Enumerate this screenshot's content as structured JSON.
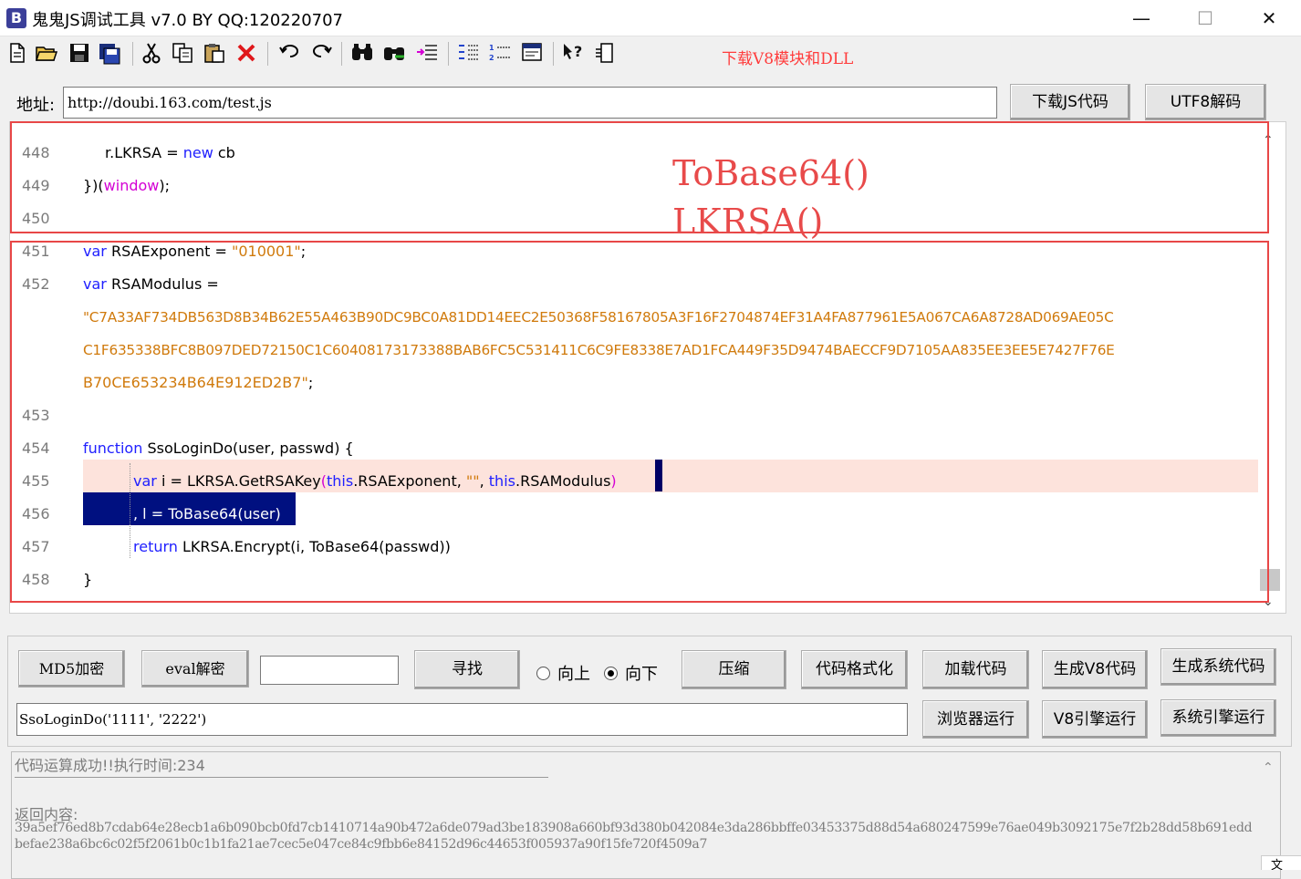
{
  "window": {
    "title": "鬼鬼JS调试工具 v7.0 BY QQ:120220707",
    "app_icon_letter": "B",
    "minimize": "—",
    "maximize": "☐",
    "close": "✕"
  },
  "toolbar": {
    "download_v8_link": "下载V8模块和DLL"
  },
  "address": {
    "label": "地址:",
    "value": "http://doubi.163.com/test.js",
    "download_js_button": "下载JS代码",
    "utf8_decode_button": "UTF8解码"
  },
  "editor": {
    "lines": [
      {
        "num": "448"
      },
      {
        "num": "449"
      },
      {
        "num": "450"
      },
      {
        "num": "451"
      },
      {
        "num": "452"
      },
      {
        "num": ""
      },
      {
        "num": ""
      },
      {
        "num": "453"
      },
      {
        "num": "454"
      },
      {
        "num": "455"
      },
      {
        "num": "456"
      },
      {
        "num": "457"
      },
      {
        "num": "458"
      }
    ],
    "tokens": {
      "l448_a": "r.LKRSA = ",
      "l448_kw": "new",
      "l448_b": " cb",
      "l449_a": "})(",
      "l449_kw": "window",
      "l449_b": ");",
      "l451_kw": "var",
      "l451_a": " RSAExponent = ",
      "l451_str": "\"010001\"",
      "l451_b": ";",
      "l452_kw": "var",
      "l452_a": " RSAModulus =",
      "l452_str1": "\"C7A33AF734DB563D8B34B62E55A463B90DC9BC0A81DD14EEC2E50368F58167805A3F16F2704874EF31A4FA877961E5A067CA6A8728AD069AE05C",
      "l452_str2": "C1F635338BFC8B097DED72150C1C60408173173388BAB6FC5C531411C6C9FE8338E7AD1FCA449F35D9474BAECCF9D7105AA835EE3EE5E7427F76E",
      "l452_str3": "B70CE653234B64E912ED2B7\"",
      "l452_end": ";",
      "l454_kw": "function",
      "l454_a": " SsoLoginDo(user, passwd) {",
      "l455_kw": "var",
      "l455_a": " i = LKRSA.GetRSAKey",
      "l455_p1": "(",
      "l455_kw2": "this",
      "l455_b": ".RSAExponent, ",
      "l455_str": "\"\"",
      "l455_c": ", ",
      "l455_kw3": "this",
      "l455_d": ".RSAModulus",
      "l455_p2": ")",
      "l456_a": ", l = ToBase64(user)",
      "l457_kw": "return",
      "l457_a": " LKRSA.Encrypt(i, ToBase64(passwd))",
      "l458_a": "}"
    }
  },
  "annotation": {
    "line1": "ToBase64()",
    "line2": "LKRSA()"
  },
  "controls": {
    "md5_button": "MD5加密",
    "eval_decode_button": "eval解密",
    "search_value": "",
    "find_button": "寻找",
    "radio_up": "向上",
    "radio_down": "向下",
    "compress_button": "压缩",
    "format_button": "代码格式化",
    "load_code_button": "加载代码",
    "gen_v8_button": "生成V8代码",
    "gen_sys_button": "生成系统代码",
    "call_value": "SsoLoginDo('1111', '2222')",
    "browser_run_button": "浏览器运行",
    "v8_run_button": "V8引擎运行",
    "sys_run_button": "系统引擎运行"
  },
  "output": {
    "status": "代码运算成功!!执行时间:234",
    "return_label": "返回内容:",
    "hash": "39a5ef76ed8b7cdab64e28ecb1a6b090bcb0fd7cb1410714a90b472a6de079ad3be183908a660bf93d380b042084e3da286bbffe03453375d88d54a680247599e76ae049b3092175e7f2b28dd58b691eddbefae238a6bc6c02f5f2061b0c1b1fa21ae7cec5e047ce84c9fbb6e84152d96c44653f005937a90f15fe720f4509a7",
    "corner": "文"
  },
  "colors": {
    "keyword": "#2020ff",
    "keyword_magenta": "#d400d4",
    "string": "#d07a0c",
    "annotation": "#e84a4a",
    "selection": "#001080",
    "highlight_line": "#fde3dc"
  },
  "icons": [
    "new-file-icon",
    "open-folder-icon",
    "save-icon",
    "save-all-icon",
    "cut-icon",
    "copy-icon",
    "paste-icon",
    "delete-icon",
    "undo-icon",
    "redo-icon",
    "find-icon",
    "find-replace-icon",
    "indent-icon",
    "outdent-icon",
    "line-numbers-icon",
    "window-icon",
    "help-icon",
    "panel-icon"
  ]
}
